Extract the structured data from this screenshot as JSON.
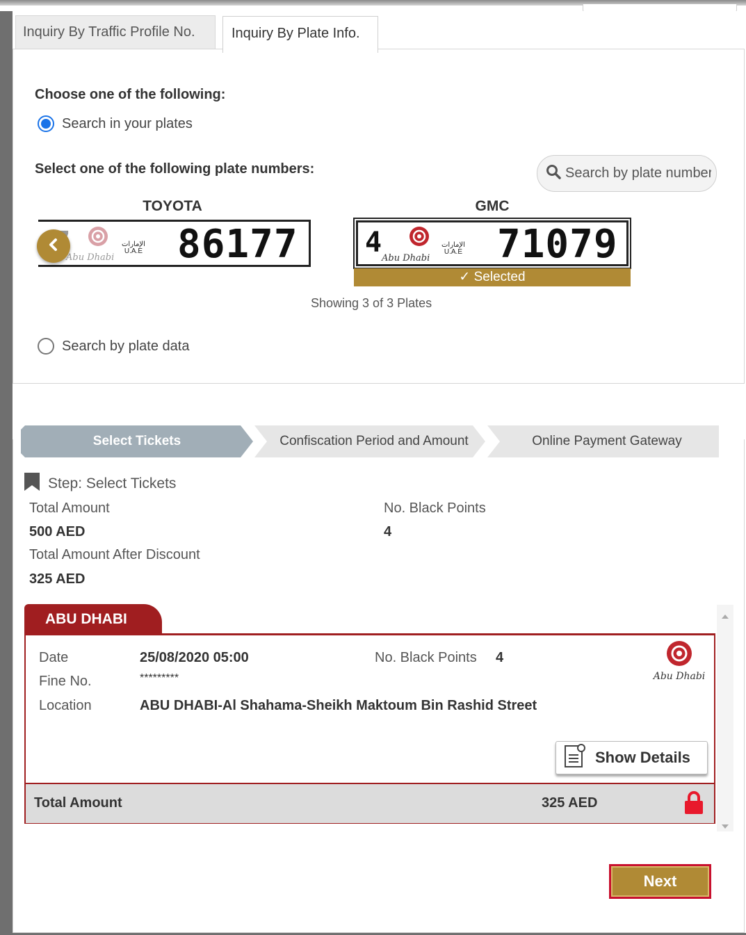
{
  "tabs": {
    "profile": "Inquiry By Traffic Profile No.",
    "plate": "Inquiry By Plate Info."
  },
  "choose_heading": "Choose one of the following:",
  "option_your_plates": "Search in your plates",
  "select_plate_heading": "Select one of the following plate numbers:",
  "search": {
    "placeholder": "Search by plate number"
  },
  "plates": [
    {
      "brand": "TOYOTA",
      "code": "7",
      "number": "86177",
      "emirate_logo": "Abu Dhabi",
      "uae_label": "U.A.E"
    },
    {
      "brand": "GMC",
      "code": "4",
      "number": "71079",
      "emirate_logo": "Abu Dhabi",
      "uae_label": "U.A.E",
      "selected_label": "✓ Selected"
    }
  ],
  "showing_text": "Showing 3 of 3 Plates",
  "option_plate_data": "Search by plate data",
  "steps": [
    "Select Tickets",
    "Confiscation Period and Amount",
    "Online Payment Gateway"
  ],
  "step_title": "Step: Select Tickets",
  "summary": {
    "total_amount_label": "Total Amount",
    "total_amount": "500 AED",
    "black_points_label": "No. Black Points",
    "black_points": "4",
    "after_discount_label": "Total Amount After Discount",
    "after_discount": "325 AED"
  },
  "ticket": {
    "emirate": "ABU DHABI",
    "date_label": "Date",
    "date": "25/08/2020 05:00",
    "black_points_label": "No. Black Points",
    "black_points": "4",
    "fine_label": "Fine No.",
    "fine_no": "*********",
    "location_label": "Location",
    "location": "ABU DHABI-Al Shahama-Sheikh Maktoum Bin Rashid Street",
    "logo_text": "Abu Dhabi",
    "details_button": "Show Details",
    "total_label": "Total Amount",
    "total": "325 AED"
  },
  "next_button": "Next",
  "colors": {
    "gold": "#b08a35",
    "red": "#a01e20",
    "step_active": "#a1aeb7",
    "radio": "#1a73e8"
  }
}
